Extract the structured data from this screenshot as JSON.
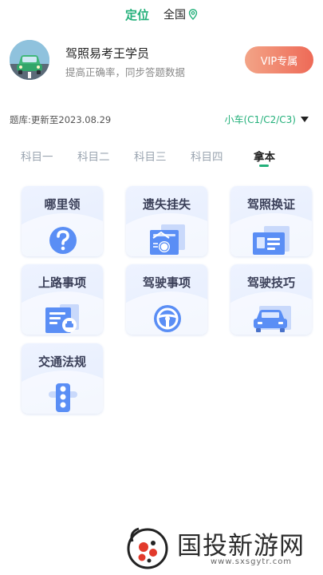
{
  "topbar": {
    "location_tab": "定位",
    "region_label": "全国"
  },
  "profile": {
    "name": "驾照易考王学员",
    "description": "提高正确率，同步答题数据",
    "vip_label": "VIP专属"
  },
  "bank": {
    "update_info": "题库:更新至2023.08.29",
    "car_type": "小车(C1/C2/C3)"
  },
  "subjects": {
    "tabs": [
      "科目一",
      "科目二",
      "科目三",
      "科目四",
      "拿本"
    ],
    "active_index": 4
  },
  "services": [
    {
      "label": "哪里领",
      "icon": "question-icon"
    },
    {
      "label": "遗失挂失",
      "icon": "lost-report-icon"
    },
    {
      "label": "驾照换证",
      "icon": "license-card-icon"
    },
    {
      "label": "上路事项",
      "icon": "road-document-icon"
    },
    {
      "label": "驾驶事项",
      "icon": "steering-wheel-icon"
    },
    {
      "label": "驾驶技巧",
      "icon": "car-icon"
    },
    {
      "label": "交通法规",
      "icon": "traffic-light-icon"
    }
  ],
  "watermark": {
    "title": "国投新游网",
    "url": "www.sxsgytr.com"
  },
  "colors": {
    "accent": "#23b07a",
    "vip_start": "#f3a487",
    "vip_end": "#ee6a57",
    "icon_blue": "#5a8ef5"
  }
}
